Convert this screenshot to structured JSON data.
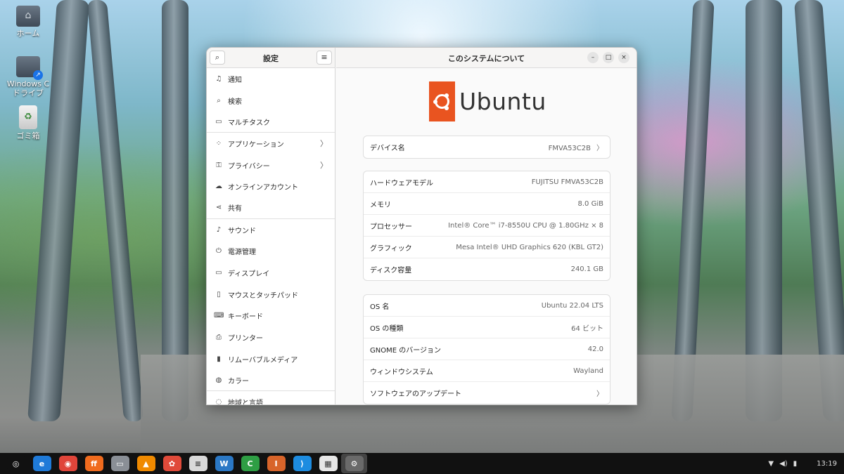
{
  "desktop": {
    "icons": [
      {
        "label": "ホーム",
        "icon": "home-folder-icon"
      },
      {
        "label": "Windows Cドライブ",
        "icon": "drive-folder-icon"
      },
      {
        "label": "ゴミ箱",
        "icon": "trash-icon"
      }
    ]
  },
  "settings": {
    "sidebar_title": "設定",
    "items": [
      {
        "label": "通知",
        "icon": "bell-icon"
      },
      {
        "label": "検索",
        "icon": "search-icon"
      },
      {
        "label": "マルチタスク",
        "icon": "multitask-icon"
      },
      {
        "label": "アプリケーション",
        "icon": "apps-grid-icon",
        "chevron": "〉"
      },
      {
        "label": "プライバシー",
        "icon": "lock-icon",
        "chevron": "〉"
      },
      {
        "label": "オンラインアカウント",
        "icon": "cloud-icon"
      },
      {
        "label": "共有",
        "icon": "share-icon"
      },
      {
        "label": "サウンド",
        "icon": "music-note-icon"
      },
      {
        "label": "電源管理",
        "icon": "power-icon"
      },
      {
        "label": "ディスプレイ",
        "icon": "display-icon"
      },
      {
        "label": "マウスとタッチパッド",
        "icon": "mouse-icon"
      },
      {
        "label": "キーボード",
        "icon": "keyboard-icon"
      },
      {
        "label": "プリンター",
        "icon": "printer-icon"
      },
      {
        "label": "リムーバブルメディア",
        "icon": "usb-icon"
      },
      {
        "label": "カラー",
        "icon": "color-palette-icon"
      },
      {
        "label": "地域と言語",
        "icon": "globe-icon"
      }
    ]
  },
  "about": {
    "title": "このシステムについて",
    "logo_text": "Ubuntu",
    "device": {
      "key": "デバイス名",
      "value": "FMVA53C2B",
      "chevron": "〉"
    },
    "hardware": [
      {
        "key": "ハードウェアモデル",
        "value": "FUJITSU FMVA53C2B"
      },
      {
        "key": "メモリ",
        "value": "8.0 GiB"
      },
      {
        "key": "プロセッサー",
        "value": "Intel® Core™ i7-8550U CPU @ 1.80GHz × 8"
      },
      {
        "key": "グラフィック",
        "value": "Mesa Intel® UHD Graphics 620 (KBL GT2)"
      },
      {
        "key": "ディスク容量",
        "value": "240.1 GB"
      }
    ],
    "os": [
      {
        "key": "OS 名",
        "value": "Ubuntu 22.04 LTS"
      },
      {
        "key": "OS の種類",
        "value": "64 ビット"
      },
      {
        "key": "GNOME のバージョン",
        "value": "42.0"
      },
      {
        "key": "ウィンドウシステム",
        "value": "Wayland"
      },
      {
        "key": "ソフトウェアのアップデート",
        "value": "〉"
      }
    ]
  },
  "window_controls": {
    "minimize": "–",
    "maximize": "□",
    "close": "×"
  },
  "taskbar": {
    "apps": [
      {
        "icon": "ubuntu-menu-icon",
        "color": "#111111",
        "glyph": "◎"
      },
      {
        "icon": "edge-icon",
        "color": "#1f7ad8",
        "glyph": "e"
      },
      {
        "icon": "chrome-icon",
        "color": "#e0453a",
        "glyph": "◉"
      },
      {
        "icon": "firefox-icon",
        "color": "#f06b1e",
        "glyph": "ff"
      },
      {
        "icon": "files-icon",
        "color": "#8a8f96",
        "glyph": "▭"
      },
      {
        "icon": "vlc-icon",
        "color": "#f08a00",
        "glyph": "▲"
      },
      {
        "icon": "app-center-icon",
        "color": "#e04a3a",
        "glyph": "✿"
      },
      {
        "icon": "text-editor-icon",
        "color": "#d9d9d9",
        "glyph": "≡"
      },
      {
        "icon": "writer-icon",
        "color": "#2b78c5",
        "glyph": "W"
      },
      {
        "icon": "calc-icon",
        "color": "#2e9e44",
        "glyph": "C"
      },
      {
        "icon": "impress-icon",
        "color": "#d8642a",
        "glyph": "I"
      },
      {
        "icon": "vscode-icon",
        "color": "#1d8ce0",
        "glyph": "⟩"
      },
      {
        "icon": "store-icon",
        "color": "#e7e7e7",
        "glyph": "▦"
      },
      {
        "icon": "settings-icon",
        "color": "#6a6a6a",
        "glyph": "⚙"
      }
    ],
    "active_index": 13,
    "tray": {
      "network": "▼",
      "volume": "◀)",
      "battery": "▮",
      "time": "13:19"
    }
  }
}
